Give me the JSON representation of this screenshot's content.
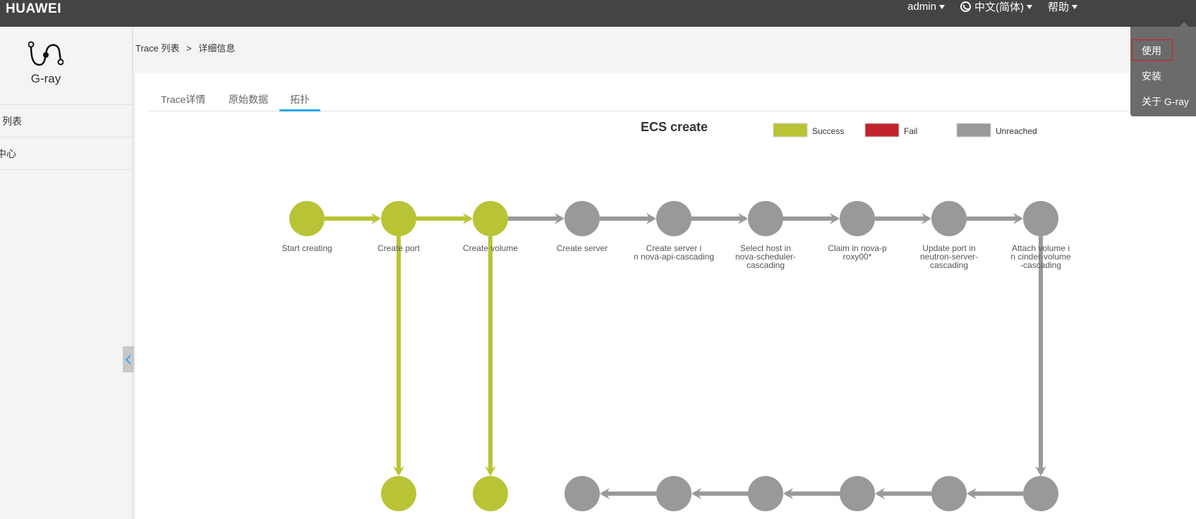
{
  "header": {
    "brand": "HUAWEI",
    "user_menu": "admin",
    "language_menu": "中文(简体)",
    "help_menu": "帮助"
  },
  "help_dropdown": {
    "items": [
      {
        "label": "使用",
        "highlighted": true
      },
      {
        "label": "安装",
        "highlighted": false
      },
      {
        "label": "关于 G-ray",
        "highlighted": false
      }
    ]
  },
  "sidebar": {
    "app_name": "G-ray",
    "items": [
      {
        "label": "列表"
      },
      {
        "label": "中心"
      }
    ]
  },
  "breadcrumb": {
    "parent": "Trace 列表",
    "separator": ">",
    "current": "详细信息"
  },
  "tabs": [
    {
      "label": "Trace详情",
      "active": false
    },
    {
      "label": "原始数据",
      "active": false
    },
    {
      "label": "拓扑",
      "active": true
    }
  ],
  "topology": {
    "title": "ECS create",
    "legend": [
      {
        "label": "Success",
        "color": "#b8c435"
      },
      {
        "label": "Fail",
        "color": "#c1232b"
      },
      {
        "label": "Unreached",
        "color": "#999999"
      }
    ],
    "status_colors": {
      "success": "#b8c435",
      "fail": "#c1232b",
      "unreached": "#999999"
    },
    "top_row": [
      {
        "id": "n1",
        "label": [
          "Start creating"
        ],
        "status": "success"
      },
      {
        "id": "n2",
        "label": [
          "Create port"
        ],
        "status": "success"
      },
      {
        "id": "n3",
        "label": [
          "Create volume"
        ],
        "status": "success"
      },
      {
        "id": "n4",
        "label": [
          "Create server"
        ],
        "status": "unreached"
      },
      {
        "id": "n5",
        "label": [
          "Create server i",
          "n nova-api-cascading"
        ],
        "status": "unreached"
      },
      {
        "id": "n6",
        "label": [
          "Select host in",
          "nova-scheduler-",
          "cascading"
        ],
        "status": "unreached"
      },
      {
        "id": "n7",
        "label": [
          "Claim in nova-p",
          "roxy00*"
        ],
        "status": "unreached"
      },
      {
        "id": "n8",
        "label": [
          "Update port in",
          "neutron-server-",
          "cascading"
        ],
        "status": "unreached"
      },
      {
        "id": "n9",
        "label": [
          "Attach volume i",
          "n cinder-volume",
          "-cascading"
        ],
        "status": "unreached"
      }
    ],
    "bottom_row": [
      {
        "id": "b2",
        "column": 1,
        "status": "success"
      },
      {
        "id": "b3",
        "column": 2,
        "status": "success"
      },
      {
        "id": "b4",
        "column": 3,
        "status": "unreached"
      },
      {
        "id": "b5",
        "column": 4,
        "status": "unreached"
      },
      {
        "id": "b6",
        "column": 5,
        "status": "unreached"
      },
      {
        "id": "b7",
        "column": 6,
        "status": "unreached"
      },
      {
        "id": "b8",
        "column": 7,
        "status": "unreached"
      },
      {
        "id": "b9",
        "column": 8,
        "status": "unreached"
      }
    ],
    "edges": [
      {
        "from": "n1",
        "to": "n2",
        "status": "success"
      },
      {
        "from": "n2",
        "to": "n3",
        "status": "success"
      },
      {
        "from": "n3",
        "to": "n4",
        "status": "unreached"
      },
      {
        "from": "n4",
        "to": "n5",
        "status": "unreached"
      },
      {
        "from": "n5",
        "to": "n6",
        "status": "unreached"
      },
      {
        "from": "n6",
        "to": "n7",
        "status": "unreached"
      },
      {
        "from": "n7",
        "to": "n8",
        "status": "unreached"
      },
      {
        "from": "n8",
        "to": "n9",
        "status": "unreached"
      },
      {
        "from": "n2",
        "to": "b2",
        "status": "success"
      },
      {
        "from": "n3",
        "to": "b3",
        "status": "success"
      },
      {
        "from": "n9",
        "to": "b9",
        "status": "unreached"
      },
      {
        "from": "b9",
        "to": "b8",
        "status": "unreached"
      },
      {
        "from": "b8",
        "to": "b7",
        "status": "unreached"
      },
      {
        "from": "b7",
        "to": "b6",
        "status": "unreached"
      },
      {
        "from": "b6",
        "to": "b5",
        "status": "unreached"
      },
      {
        "from": "b5",
        "to": "b4",
        "status": "unreached"
      }
    ]
  }
}
